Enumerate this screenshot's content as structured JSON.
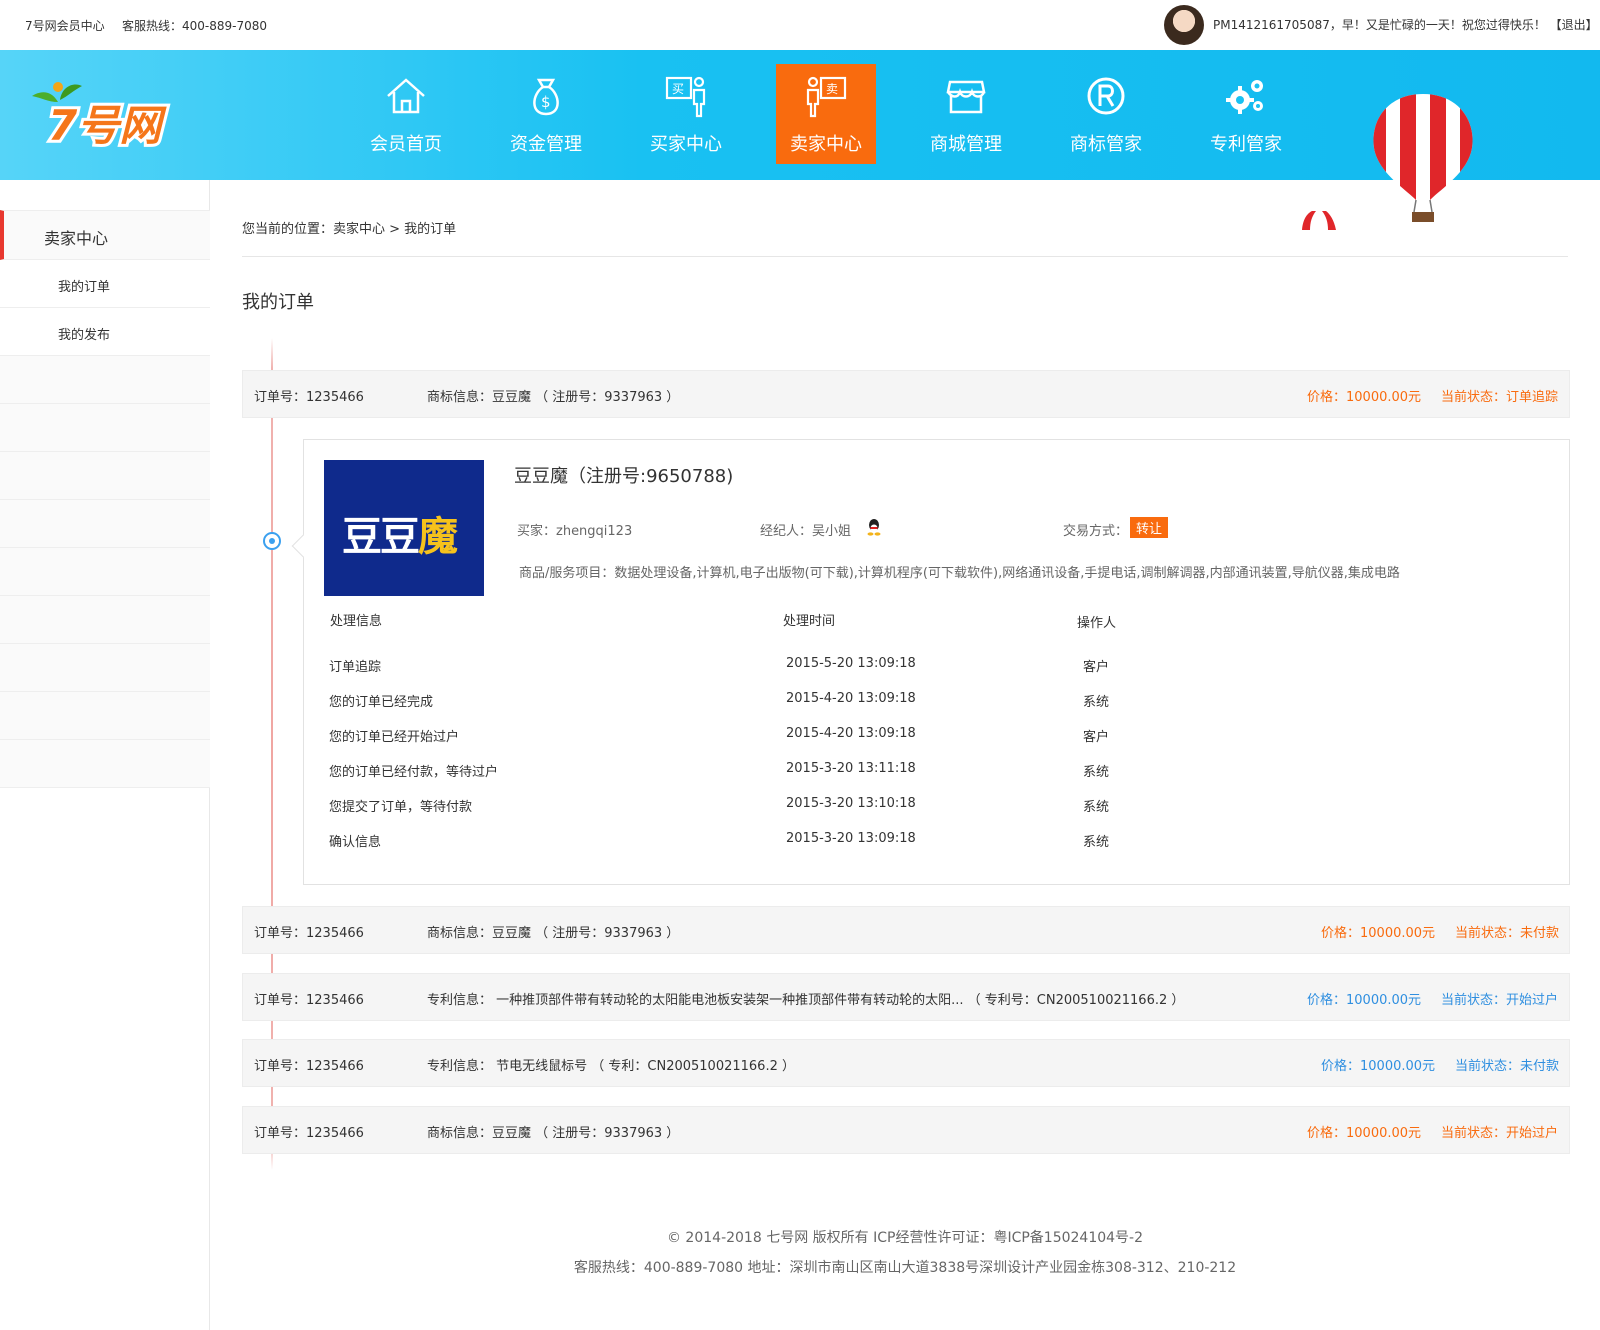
{
  "topbar": {
    "site_name": "7号网会员中心",
    "hotline": "客服热线：400-889-7080",
    "greeting": "PM1412161705087，早！又是忙碌的一天！祝您过得快乐！",
    "logout": "【退出】"
  },
  "logo": {
    "text": "7号网"
  },
  "nav": [
    {
      "label": "会员首页",
      "icon": "home-icon"
    },
    {
      "label": "资金管理",
      "icon": "money-bag-icon"
    },
    {
      "label": "买家中心",
      "icon": "buyer-icon"
    },
    {
      "label": "卖家中心",
      "icon": "seller-icon",
      "active": true
    },
    {
      "label": "商城管理",
      "icon": "store-icon"
    },
    {
      "label": "商标管家",
      "icon": "registered-icon"
    },
    {
      "label": "专利管家",
      "icon": "gears-icon"
    }
  ],
  "sidebar": {
    "header": "卖家中心",
    "items": [
      "我的订单",
      "我的发布"
    ]
  },
  "breadcrumb": "您当前的位置：卖家中心 > 我的订单",
  "page_title": "我的订单",
  "orders": [
    {
      "no": "订单号：1235466",
      "info": "商标信息：豆豆魔 （ 注册号：9337963 ）",
      "price": "价格：10000.00元",
      "status": "当前状态：订单追踪",
      "color": "orange"
    },
    {
      "no": "订单号：1235466",
      "info": "商标信息：豆豆魔 （ 注册号：9337963 ）",
      "price": "价格：10000.00元",
      "status": "当前状态：未付款",
      "color": "orange"
    },
    {
      "no": "订单号：1235466",
      "info": "专利信息： 一种推顶部件带有转动轮的太阳能电池板安装架一种推顶部件带有转动轮的太阳... （ 专利号：CN200510021166.2 ）",
      "price": "价格：10000.00元",
      "status": "当前状态：开始过户",
      "color": "blue"
    },
    {
      "no": "订单号：1235466",
      "info": "专利信息： 节电无线鼠标号 （ 专利：CN200510021166.2 ）",
      "price": "价格：10000.00元",
      "status": "当前状态：未付款",
      "color": "blue"
    },
    {
      "no": "订单号：1235466",
      "info": "商标信息：豆豆魔 （ 注册号：9337963 ）",
      "price": "价格：10000.00元",
      "status": "当前状态：开始过户",
      "color": "orange"
    }
  ],
  "detail": {
    "brand_text_a": "豆豆",
    "brand_text_b": "魔",
    "title": "豆豆魔（注册号:9650788)",
    "buyer": "买家：zhengqi123",
    "agent": "经纪人：吴小姐",
    "trade_label": "交易方式：",
    "trade_value": "转让",
    "goods": "商品/服务项目：数据处理设备,计算机,电子出版物(可下载),计算机程序(可下载软件),网络通讯设备,手提电话,调制解调器,内部通讯装置,导航仪器,集成电路",
    "log_headers": [
      "处理信息",
      "处理时间",
      "操作人"
    ],
    "logs": [
      {
        "info": "订单追踪",
        "time": "2015-5-20  13:09:18",
        "op": "客户"
      },
      {
        "info": "您的订单已经完成",
        "time": "2015-4-20  13:09:18",
        "op": "系统"
      },
      {
        "info": "您的订单已经开始过户",
        "time": "2015-4-20  13:09:18",
        "op": "客户"
      },
      {
        "info": "您的订单已经付款，等待过户",
        "time": "2015-3-20  13:11:18",
        "op": "系统"
      },
      {
        "info": "您提交了订单，等待付款",
        "time": "2015-3-20  13:10:18",
        "op": "系统"
      },
      {
        "info": "确认信息",
        "time": "2015-3-20  13:09:18",
        "op": "系统"
      }
    ]
  },
  "footer": {
    "line1": "© 2014-2018 七号网 版权所有 ICP经营性许可证：粤ICP备15024104号-2",
    "line2": "客服热线：400-889-7080  地址：深圳市南山区南山大道3838号深圳设计产业园金栋308-312、210-212"
  },
  "colors": {
    "accent": "#f96b0e",
    "banner": "#12b9ef",
    "blue": "#2f8fe0",
    "sidebar_marker": "#e8382f"
  }
}
